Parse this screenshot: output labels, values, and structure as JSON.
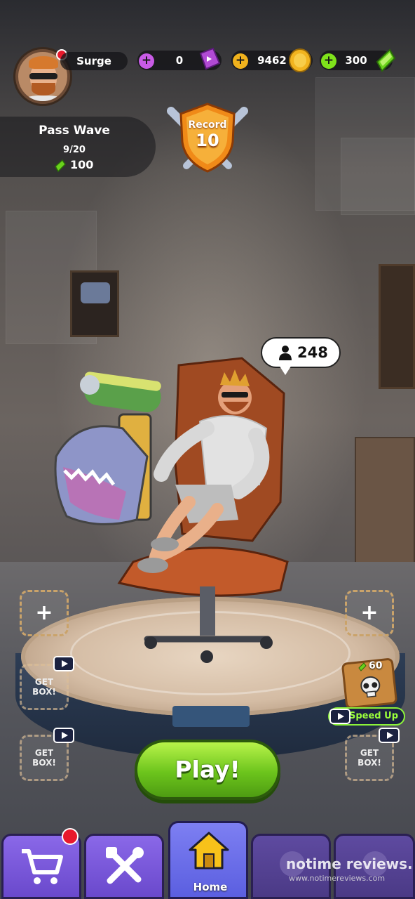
{
  "player": {
    "name": "Surge"
  },
  "resources": [
    {
      "icon": "ticket-icon",
      "value": "0",
      "color": "#c85be6"
    },
    {
      "icon": "coin-icon",
      "value": "9462",
      "color": "#f0b21d"
    },
    {
      "icon": "gem-icon",
      "value": "300",
      "color": "#7fe21b"
    }
  ],
  "pass": {
    "title": "Pass Wave",
    "progress": "9/20",
    "reward": "100",
    "reward_icon": "gem-icon"
  },
  "record": {
    "label": "Record",
    "value": "10"
  },
  "viewers": {
    "icon": "user-icon",
    "count": "248"
  },
  "slots": {
    "left_top_plus": "+",
    "right_top_plus": "+",
    "get_box_left_1": "GET BOX!",
    "get_box_left_2": "GET BOX!",
    "get_box_right": "GET BOX!"
  },
  "crate": {
    "cost": "60",
    "speed_label": "Speed Up"
  },
  "play_button": "Play!",
  "nav": {
    "items": [
      {
        "icon": "cart-icon",
        "label": ""
      },
      {
        "icon": "tools-icon",
        "label": ""
      },
      {
        "icon": "home-icon",
        "label": "Home"
      },
      {
        "icon": "locked-icon",
        "label": ""
      },
      {
        "icon": "locked-icon",
        "label": ""
      }
    ]
  },
  "watermark": {
    "text": "notime reviews.",
    "url": "www.notimereviews.com"
  },
  "colors": {
    "play": "#6cc41c",
    "nav": "#7a58dc",
    "accent_red": "#e8192c"
  }
}
